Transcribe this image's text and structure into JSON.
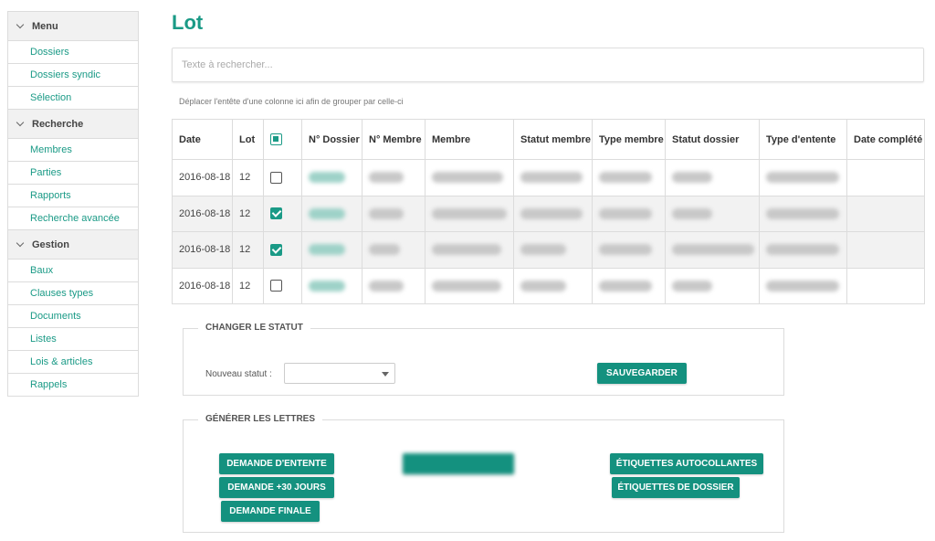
{
  "sidebar": {
    "sections": [
      {
        "title": "Menu",
        "items": [
          "Dossiers",
          "Dossiers syndic",
          "Sélection"
        ]
      },
      {
        "title": "Recherche",
        "items": [
          "Membres",
          "Parties",
          "Rapports",
          "Recherche avancée"
        ]
      },
      {
        "title": "Gestion",
        "items": [
          "Baux",
          "Clauses types",
          "Documents",
          "Listes",
          "Lois & articles",
          "Rappels"
        ]
      }
    ]
  },
  "page": {
    "title": "Lot",
    "search_placeholder": "Texte à rechercher...",
    "group_hint": "Déplacer l'entête d'une colonne ici afin de grouper par celle-ci"
  },
  "table": {
    "columns": [
      "Date",
      "Lot",
      "",
      "N° Dossier",
      "N° Membre",
      "Membre",
      "Statut membre",
      "Type membre",
      "Statut dossier",
      "Type d'entente",
      "Date complété"
    ],
    "rows": [
      {
        "date": "2016-08-18",
        "lot": "12",
        "checked": false
      },
      {
        "date": "2016-08-18",
        "lot": "12",
        "checked": true
      },
      {
        "date": "2016-08-18",
        "lot": "12",
        "checked": true
      },
      {
        "date": "2016-08-18",
        "lot": "12",
        "checked": false
      }
    ]
  },
  "status_panel": {
    "legend": "CHANGER LE STATUT",
    "label": "Nouveau statut :",
    "select_value": "",
    "save_label": "SAUVEGARDER"
  },
  "letters_panel": {
    "legend": "GÉNÉRER LES LETTRES",
    "buttons": {
      "demande_entente": "DEMANDE D'ENTENTE",
      "demande_30": "DEMANDE +30 JOURS",
      "demande_finale": "DEMANDE FINALE",
      "etiquettes_autocollantes": "ÉTIQUETTES AUTOCOLLANTES",
      "etiquettes_dossier": "ÉTIQUETTES DE DOSSIER"
    }
  },
  "colors": {
    "accent": "#1a9a86",
    "button": "#14917f"
  }
}
